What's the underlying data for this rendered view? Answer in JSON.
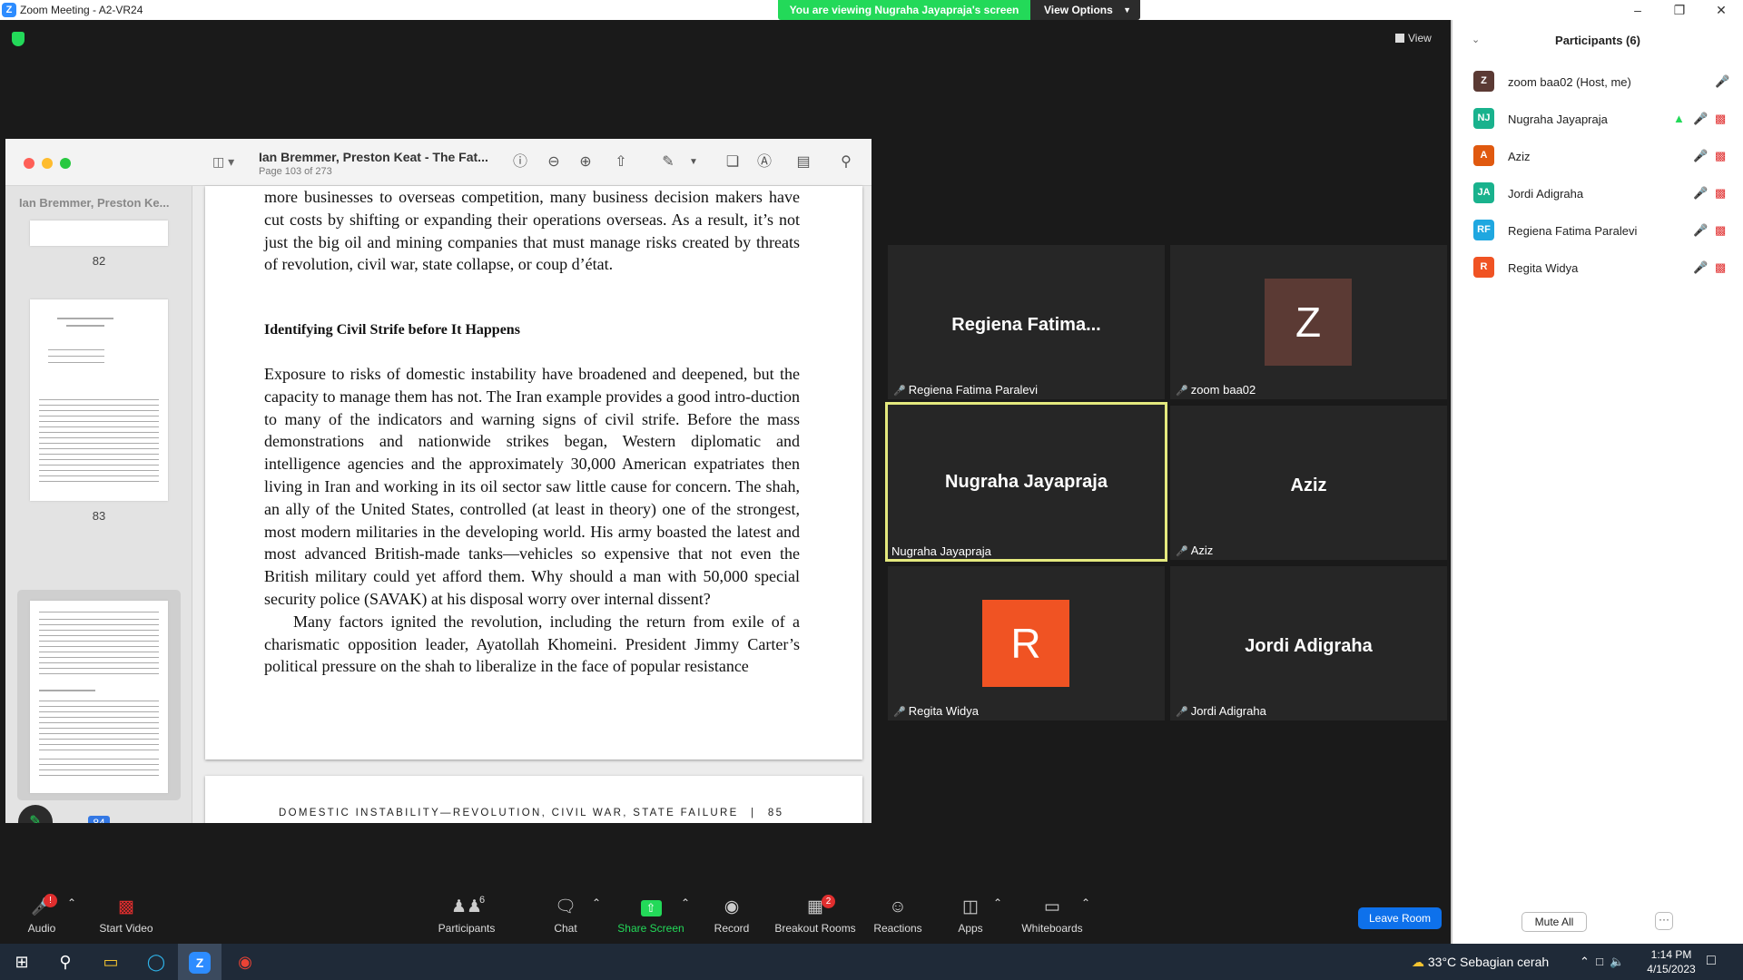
{
  "window": {
    "title": "Zoom Meeting - A2-VR24",
    "app_icon": "Z",
    "viewing_banner": "You are viewing Nugraha Jayapraja's screen",
    "view_options": "View Options",
    "view_button": "View"
  },
  "shared_screen": {
    "doc_title": "Ian Bremmer, Preston Keat - The Fat...",
    "doc_page": "Page 103 of 273",
    "sidebar_title": "Ian Bremmer, Preston Ke...",
    "thumb_pages": [
      "82",
      "83",
      "84"
    ],
    "page_paragraphs": [
      "more businesses to overseas competition, many business decision makers have cut costs by shifting or expanding their operations overseas. As a result, it’s not just the big oil and mining companies that must manage risks created by threats of revolution, civil war, state collapse, or coup d’état.",
      "Exposure to risks of domestic instability have broadened and deepened, but the capacity to manage them has not. The Iran example provides a good intro-duction to many of the indicators and warning signs of civil strife. Before the mass demonstrations and nationwide strikes began, Western diplomatic and intelligence agencies and the approximately 30,000 American expatriates then living in Iran and working in its oil sector saw little cause for concern. The shah, an ally of the United States, controlled (at least in theory) one of the strongest, most modern militaries in the developing world. His army boasted the latest and most advanced British-made tanks—vehicles so expensive that not even the British military could yet afford them. Why should a man with 50,000 special security police (SAVAK) at his disposal worry over internal dissent?",
      "Many factors ignited the revolution, including the return from exile of a charismatic opposition leader, Ayatollah Khomeini. President Jimmy Carter’s political pressure on the shah to liberalize in the face of popular resistance"
    ],
    "section_heading": "Identifying Civil Strife before It Happens",
    "running_head": "DOMESTIC INSTABILITY—REVOLUTION, CIVIL WAR, STATE FAILURE",
    "running_page": "85"
  },
  "tiles": [
    {
      "big_name": "Regiena  Fatima...",
      "label": "Regiena Fatima Paralevi"
    },
    {
      "avatar": "Z",
      "avatar_color": "#5b3a34",
      "label": "zoom baa02"
    },
    {
      "big_name": "Nugraha Jayapraja",
      "label": "Nugraha Jayapraja"
    },
    {
      "big_name": "Aziz",
      "label": "Aziz"
    },
    {
      "avatar": "R",
      "avatar_color": "#f05323",
      "label": "Regita Widya"
    },
    {
      "big_name": "Jordi Adigraha",
      "label": "Jordi Adigraha"
    }
  ],
  "participants_panel": {
    "title": "Participants (6)",
    "mute_all": "Mute All",
    "more": "···",
    "list": [
      {
        "initials": "Z",
        "color": "#5b3a34",
        "name": "zoom baa02 (Host, me)"
      },
      {
        "initials": "NJ",
        "color": "#19b28d",
        "name": "Nugraha Jayapraja"
      },
      {
        "initials": "A",
        "color": "#e0590f",
        "name": "Aziz"
      },
      {
        "initials": "JA",
        "color": "#19b28d",
        "name": "Jordi Adigraha"
      },
      {
        "initials": "RF",
        "color": "#1fa7e0",
        "name": "Regiena Fatima Paralevi"
      },
      {
        "initials": "R",
        "color": "#f05323",
        "name": "Regita Widya"
      }
    ]
  },
  "controls": {
    "audio": "Audio",
    "audio_badge": "!",
    "start_video": "Start Video",
    "participants": "Participants",
    "participants_count": "6",
    "chat": "Chat",
    "share_screen": "Share Screen",
    "record": "Record",
    "breakout_rooms": "Breakout Rooms",
    "breakout_badge": "2",
    "reactions": "Reactions",
    "apps": "Apps",
    "whiteboards": "Whiteboards",
    "leave_room": "Leave Room"
  },
  "taskbar": {
    "weather": "33°C  Sebagian cerah",
    "time": "1:14 PM",
    "date": "4/15/2023"
  },
  "colors": {
    "zoom_blue": "#0e71eb",
    "share_green": "#23d959",
    "muted_red": "#e02e2e",
    "active_speaker": "#e4e97e"
  }
}
